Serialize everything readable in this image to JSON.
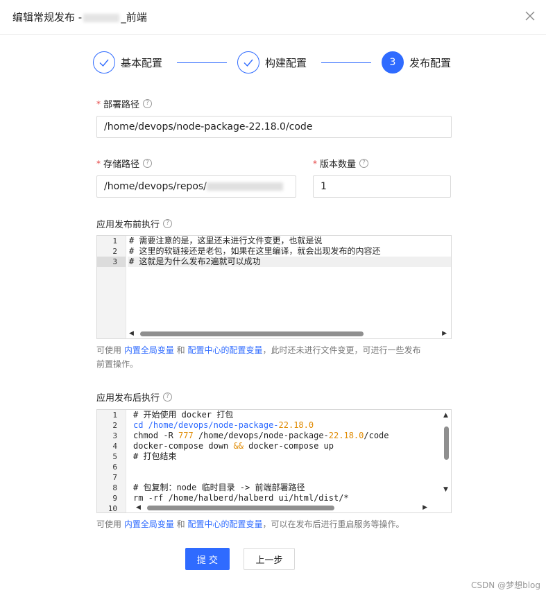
{
  "dialog": {
    "title_prefix": "编辑常规发布 -",
    "title_suffix": "_前端",
    "close_icon": "close-icon"
  },
  "steps": [
    {
      "label": "基本配置",
      "mark": "✓",
      "state": "done"
    },
    {
      "label": "构建配置",
      "mark": "✓",
      "state": "done"
    },
    {
      "label": "发布配置",
      "mark": "3",
      "state": "active"
    }
  ],
  "deploy_path": {
    "label": "部署路径",
    "value": "/home/devops/node-package-22.18.0/code"
  },
  "storage_path": {
    "label": "存储路径",
    "value": "/home/devops/repos/"
  },
  "version_count": {
    "label": "版本数量",
    "value": "1"
  },
  "pre_exec": {
    "label": "应用发布前执行",
    "lines": [
      "# 需要注意的是，这里还未进行文件变更，也就是说",
      "# 这里的软链接还是老包，如果在这里编译，就会出现发布的内容还",
      "# 这就是为什么发布2遍就可以成功"
    ],
    "line_numbers": [
      "1",
      "2",
      "3"
    ],
    "hint_prefix": "可使用 ",
    "hint_link1": "内置全局变量",
    "hint_and": " 和 ",
    "hint_link2": "配置中心的配置变量",
    "hint_suffix": "，此时还未进行文件变更，可进行一些发布",
    "hint_suffix2": "前置操作。"
  },
  "post_exec": {
    "label": "应用发布后执行",
    "line_numbers": [
      "1",
      "2",
      "3",
      "4",
      "5",
      "6",
      "7",
      "8",
      "9",
      "10"
    ],
    "line1": "# 开始使用 docker 打包",
    "line2_a": "cd /home/devops/node-package-",
    "line2_b": "22.18.0",
    "line3_a": "chmod -R ",
    "line3_b": "777",
    "line3_c": " /home/devops/node-package-",
    "line3_d": "22.18.0",
    "line3_e": "/code",
    "line4_a": "docker-compose down ",
    "line4_b": "&&",
    "line4_c": " docker-compose up",
    "line5": "# 打包结束",
    "line8": "# 包复制：node 临时目录 -> 前端部署路径",
    "line9": "rm -rf /home/halberd/halberd ui/html/dist/*",
    "hint_prefix": "可使用 ",
    "hint_link1": "内置全局变量",
    "hint_and": " 和 ",
    "hint_link2": "配置中心的配置变量",
    "hint_suffix": "，可以在发布后进行重启服务等操作。"
  },
  "buttons": {
    "submit": "提 交",
    "prev": "上一步"
  },
  "watermark": "CSDN @梦想blog",
  "colors": {
    "primary": "#2f6bff",
    "required": "#e54545",
    "number": "#e08a00"
  }
}
